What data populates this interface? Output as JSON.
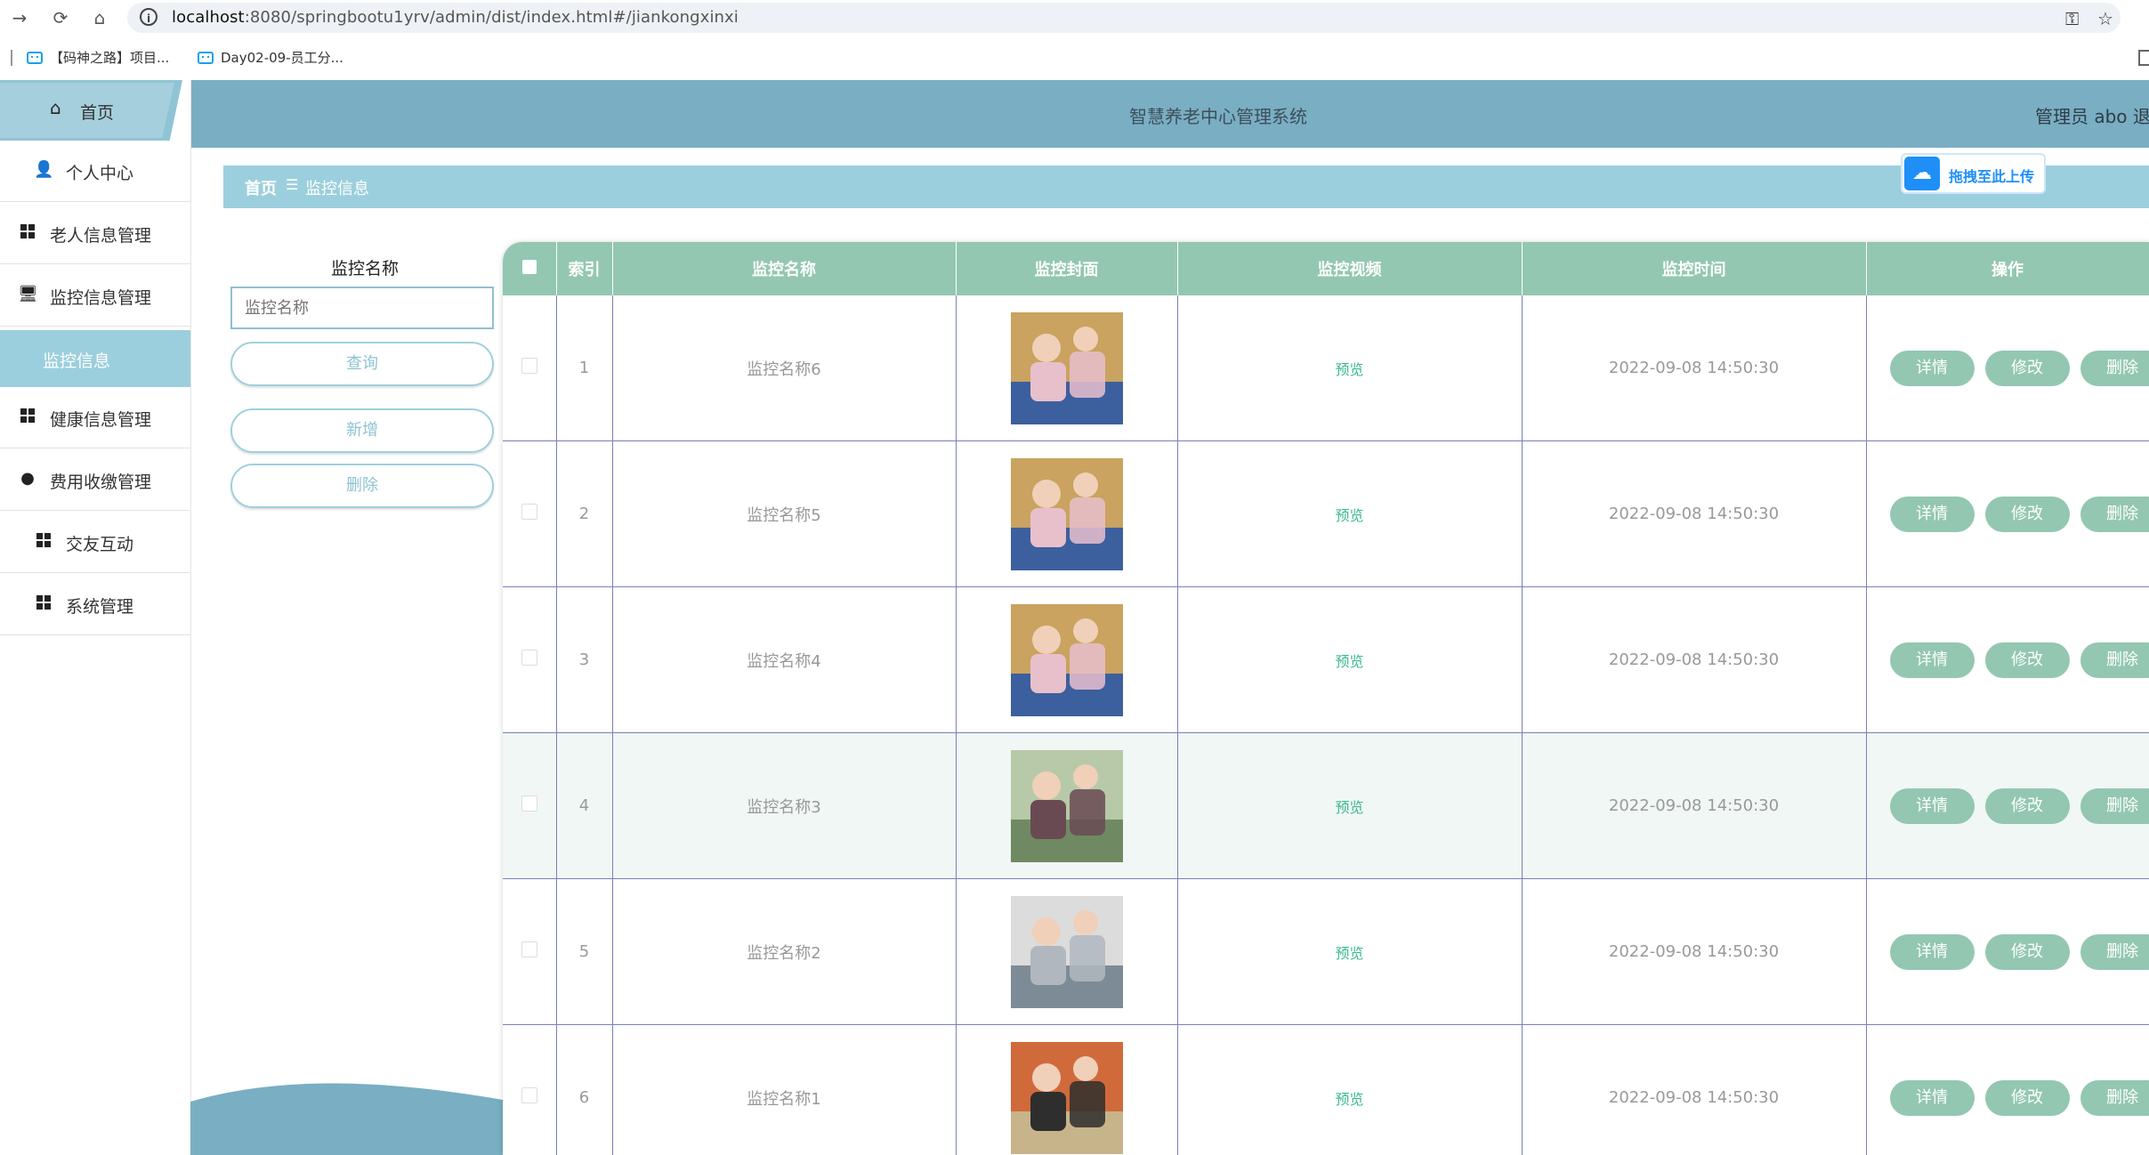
{
  "browser": {
    "url_host": "localhost",
    "url_path": ":8080/springbootu1yrv/admin/dist/index.html#/jiankongxinxi",
    "bookmarks": [
      "【码神之路】项目...",
      "Day02-09-员工分..."
    ]
  },
  "header": {
    "title": "智慧养老中心管理系统",
    "admin": "管理员 abo  退"
  },
  "upload_badge": {
    "label": "拖拽至此上传"
  },
  "sidebar": {
    "home": "首页",
    "items": [
      {
        "label": "个人中心",
        "icon": "user-icon"
      },
      {
        "label": "老人信息管理",
        "icon": "grid-icon"
      },
      {
        "label": "监控信息管理",
        "icon": "monitor-icon"
      },
      {
        "label": "监控信息",
        "icon": ""
      },
      {
        "label": "健康信息管理",
        "icon": "grid-icon"
      },
      {
        "label": "费用收缴管理",
        "icon": "bulb-icon"
      },
      {
        "label": "交友互动",
        "icon": "grid-icon"
      },
      {
        "label": "系统管理",
        "icon": "grid-icon"
      }
    ]
  },
  "breadcrumb": {
    "home": "首页",
    "separator": "☰",
    "current": "监控信息"
  },
  "search": {
    "label": "监控名称",
    "placeholder": "监控名称",
    "query_button": "查询",
    "add_button": "新增",
    "delete_button": "删除"
  },
  "table": {
    "headers": [
      "索引",
      "监控名称",
      "监控封面",
      "监控视频",
      "监控时间",
      "操作"
    ],
    "rows": [
      {
        "index": "1",
        "name": "监控名称6",
        "video": "预览",
        "time": "2022-09-08 14:50:30"
      },
      {
        "index": "2",
        "name": "监控名称5",
        "video": "预览",
        "time": "2022-09-08 14:50:30"
      },
      {
        "index": "3",
        "name": "监控名称4",
        "video": "预览",
        "time": "2022-09-08 14:50:30"
      },
      {
        "index": "4",
        "name": "监控名称3",
        "video": "预览",
        "time": "2022-09-08 14:50:30"
      },
      {
        "index": "5",
        "name": "监控名称2",
        "video": "预览",
        "time": "2022-09-08 14:50:30"
      },
      {
        "index": "6",
        "name": "监控名称1",
        "video": "预览",
        "time": "2022-09-08 14:50:30"
      }
    ],
    "actions": {
      "detail": "详情",
      "edit": "修改",
      "delete": "删除"
    }
  },
  "colors": {
    "header_bg": "#79aec3",
    "accent": "#9ccfdd",
    "table_header": "#93c7b2",
    "preview_link": "#3ab98d"
  }
}
